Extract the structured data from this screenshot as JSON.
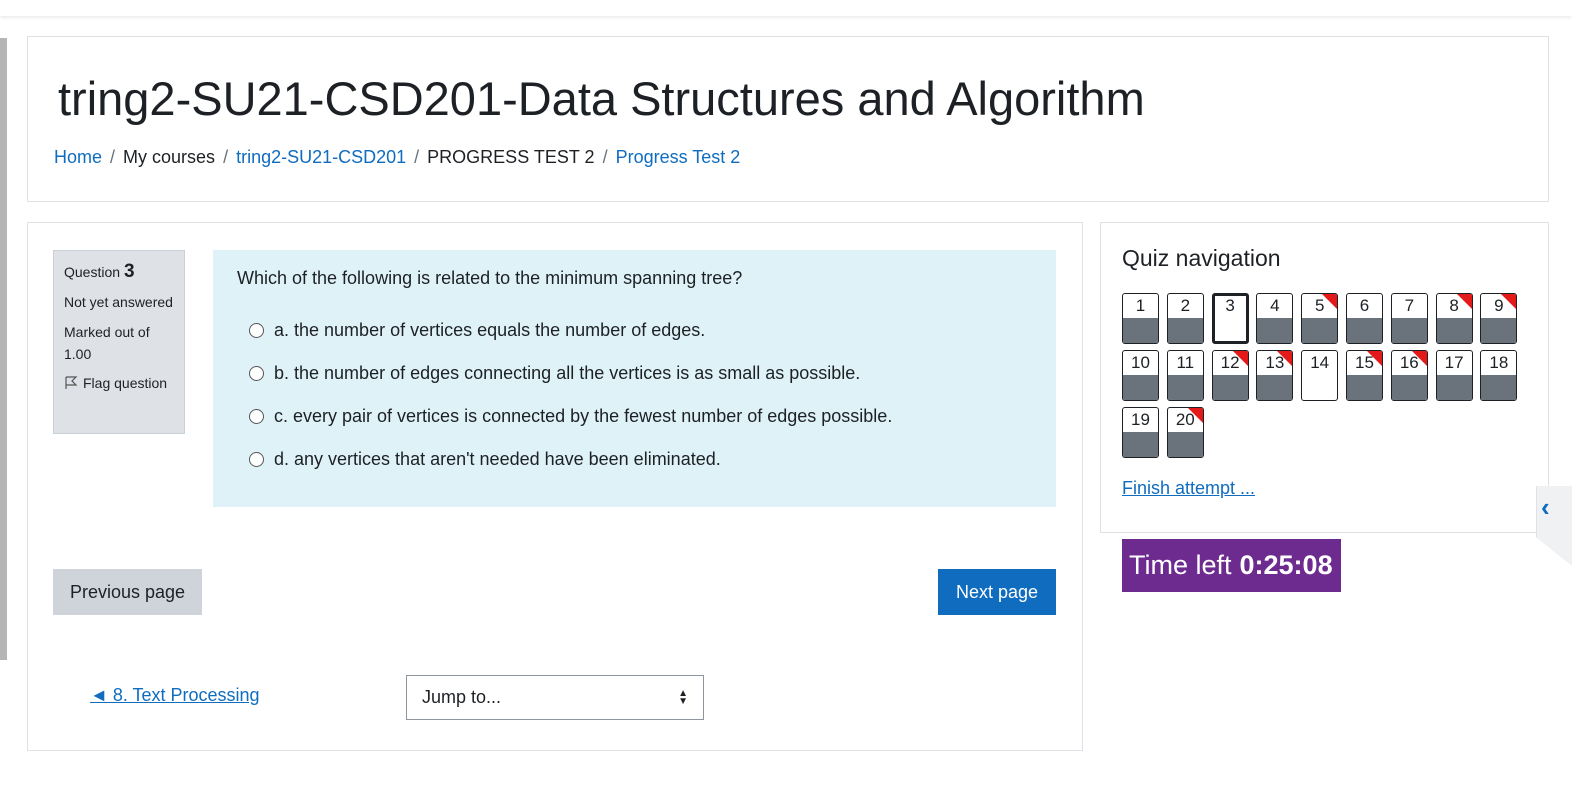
{
  "header": {
    "course_title": "tring2-SU21-CSD201-Data Structures and Algorithm",
    "breadcrumb": [
      {
        "label": "Home",
        "link": true
      },
      {
        "label": "My courses",
        "link": false
      },
      {
        "label": "tring2-SU21-CSD201",
        "link": true
      },
      {
        "label": "PROGRESS TEST 2",
        "link": false
      },
      {
        "label": "Progress Test 2",
        "link": true
      }
    ]
  },
  "question_info": {
    "label": "Question",
    "number": "3",
    "state": "Not yet answered",
    "grade": "Marked out of 1.00",
    "flag_label": "Flag question"
  },
  "question": {
    "text": "Which of the following is related to the minimum spanning tree?",
    "answers": [
      "a. the number of vertices equals the number of edges.",
      "b. the number of edges connecting all the vertices is as small as possible.",
      "c. every pair of vertices is connected by the fewest number of edges possible.",
      "d. any vertices that aren't needed have been eliminated."
    ]
  },
  "buttons": {
    "previous": "Previous page",
    "next": "Next page"
  },
  "activity_nav": {
    "prev_link": "◄ 8. Text Processing",
    "jump_label": "Jump to..."
  },
  "quiz_nav": {
    "title": "Quiz navigation",
    "questions": [
      {
        "n": "1",
        "answered": true,
        "flagged": false,
        "current": false
      },
      {
        "n": "2",
        "answered": true,
        "flagged": false,
        "current": false
      },
      {
        "n": "3",
        "answered": false,
        "flagged": false,
        "current": true
      },
      {
        "n": "4",
        "answered": true,
        "flagged": false,
        "current": false
      },
      {
        "n": "5",
        "answered": true,
        "flagged": true,
        "current": false
      },
      {
        "n": "6",
        "answered": true,
        "flagged": false,
        "current": false
      },
      {
        "n": "7",
        "answered": true,
        "flagged": false,
        "current": false
      },
      {
        "n": "8",
        "answered": true,
        "flagged": true,
        "current": false
      },
      {
        "n": "9",
        "answered": true,
        "flagged": true,
        "current": false
      },
      {
        "n": "10",
        "answered": true,
        "flagged": false,
        "current": false
      },
      {
        "n": "11",
        "answered": true,
        "flagged": false,
        "current": false
      },
      {
        "n": "12",
        "answered": true,
        "flagged": true,
        "current": false
      },
      {
        "n": "13",
        "answered": true,
        "flagged": true,
        "current": false
      },
      {
        "n": "14",
        "answered": false,
        "flagged": false,
        "current": false
      },
      {
        "n": "15",
        "answered": true,
        "flagged": true,
        "current": false
      },
      {
        "n": "16",
        "answered": true,
        "flagged": true,
        "current": false
      },
      {
        "n": "17",
        "answered": true,
        "flagged": false,
        "current": false
      },
      {
        "n": "18",
        "answered": true,
        "flagged": false,
        "current": false
      },
      {
        "n": "19",
        "answered": true,
        "flagged": false,
        "current": false
      },
      {
        "n": "20",
        "answered": true,
        "flagged": true,
        "current": false
      }
    ],
    "finish_label": "Finish attempt ..."
  },
  "timer": {
    "label": "Time left",
    "value": "0:25:08"
  },
  "drawer": {
    "icon": "chevron-left-icon"
  },
  "colors": {
    "link": "#0f6cbf",
    "question_bg": "#def2f8",
    "timer_bg": "#6d2b8f",
    "flag": "#e41a1a"
  }
}
